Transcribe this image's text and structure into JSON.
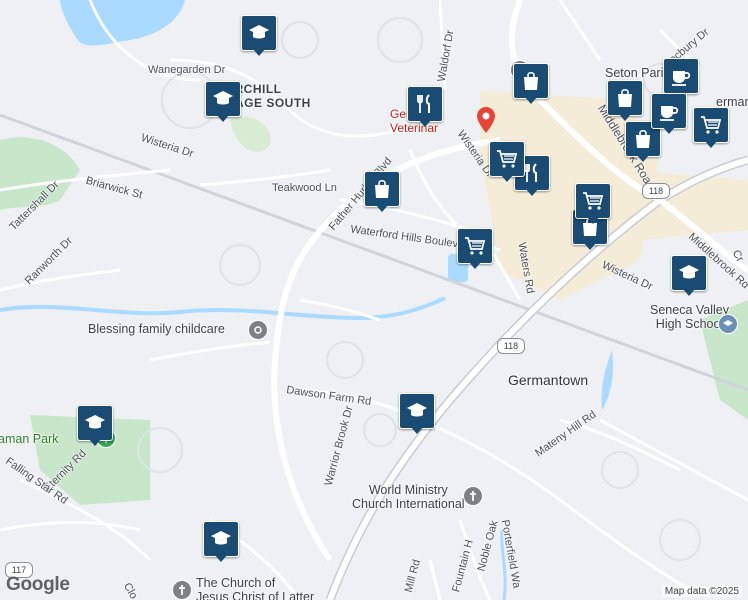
{
  "map": {
    "logo": "Google",
    "attribution": "Map data ©2025",
    "town": "Germantown",
    "area_label": "CHURCHILL\nVILLAGE SOUTH",
    "places": {
      "blessing": "Blessing family childcare",
      "world_ministry": "World Ministry\nChurch International",
      "seneca": "Seneca Valley\nHigh School",
      "seton": "Seton Parish",
      "latter_day": "The Church of\nJesus Christ of Latter",
      "park": "aman Park",
      "vet": "Germ\nVeterinar",
      "germantown_edge": "erman"
    },
    "roads": {
      "wanegarden": "Wanegarden Dr",
      "wisteria_w": "Wisteria Dr",
      "teakwood": "Teakwood Ln",
      "briarwick": "Briarwick St",
      "tattershall": "Tattershall Dr",
      "ranworth": "Ranworth Dr",
      "father_hurley": "Father Hurley Blvd",
      "waterford": "Waterford Hills Boulevard",
      "waters": "Waters Rd",
      "wisteria_e": "Wisteria Dr",
      "wisteria_n": "Wisteria Dr",
      "middlebrook": "Middlebrook Road",
      "middlebrook2": "Middlebrook Rd",
      "locbury": "Locbury Dr",
      "waldorf": "Waldorf Dr",
      "dawson": "Dawson Farm Rd",
      "warrior": "Warrior Brook Dr",
      "mateny": "Mateny Hill Rd",
      "eternity": "Eternity Rd",
      "falling_star": "Falling Star Rd",
      "noble": "Noble Oak",
      "fountain": "Fountain H",
      "mill": "Mill Rd",
      "porterfield": "Porterfield Wa",
      "clo": "Clo",
      "cr": "Cr"
    },
    "shields": {
      "r118a": "118",
      "r118b": "118",
      "r117": "117"
    },
    "markers": [
      {
        "type": "school",
        "icon": "graduation-cap-icon"
      },
      {
        "type": "school",
        "icon": "graduation-cap-icon"
      },
      {
        "type": "school",
        "icon": "graduation-cap-icon"
      },
      {
        "type": "school",
        "icon": "graduation-cap-icon"
      },
      {
        "type": "school",
        "icon": "graduation-cap-icon"
      },
      {
        "type": "school",
        "icon": "graduation-cap-icon"
      },
      {
        "type": "restaurant",
        "icon": "fork-knife-icon"
      },
      {
        "type": "restaurant",
        "icon": "fork-knife-icon"
      },
      {
        "type": "store",
        "icon": "shopping-bag-icon"
      },
      {
        "type": "store",
        "icon": "shopping-bag-icon"
      },
      {
        "type": "store",
        "icon": "shopping-bag-icon"
      },
      {
        "type": "store",
        "icon": "shopping-bag-icon"
      },
      {
        "type": "store",
        "icon": "shopping-bag-icon"
      },
      {
        "type": "grocery",
        "icon": "shopping-cart-icon"
      },
      {
        "type": "grocery",
        "icon": "shopping-cart-icon"
      },
      {
        "type": "grocery",
        "icon": "shopping-cart-icon"
      },
      {
        "type": "grocery",
        "icon": "shopping-cart-icon"
      },
      {
        "type": "cafe",
        "icon": "coffee-cup-icon"
      },
      {
        "type": "cafe",
        "icon": "coffee-cup-icon"
      }
    ],
    "colors": {
      "marker": "#1a4b73",
      "water": "#aadaff",
      "park": "#c8e6c9",
      "road": "#ffffff",
      "highway": "#c7ccd3",
      "commercial": "#f5ecd7"
    }
  }
}
